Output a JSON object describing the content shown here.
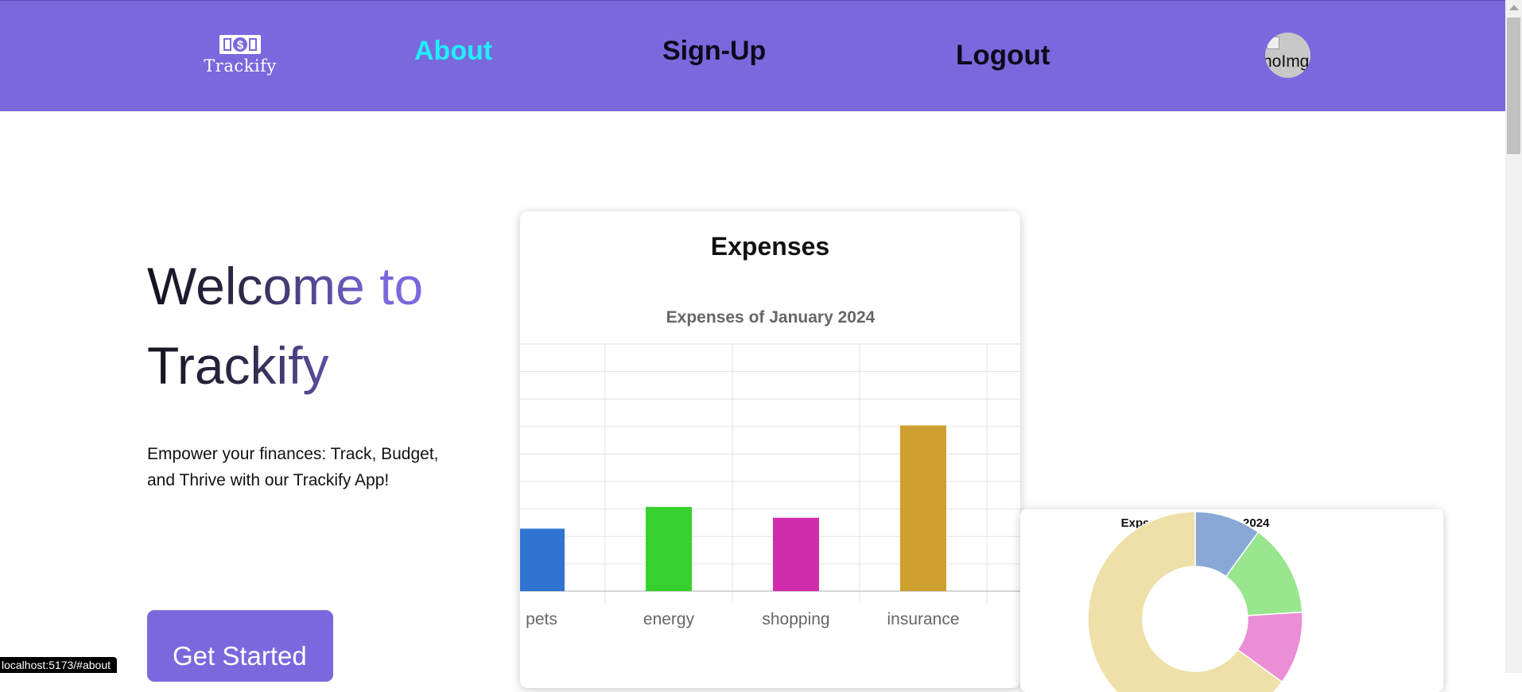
{
  "navbar": {
    "logo_text": "Trackify",
    "about": "About",
    "signup": "Sign-Up",
    "logout": "Logout",
    "avatar_alt": "noImg",
    "active_color": "#1ff0ff",
    "background": "#7b68dd"
  },
  "hero": {
    "title_line1": "Welcome to",
    "title_line2": "Trackify",
    "tagline": "Empower your finances: Track, Budget, and Thrive with our Trackify App!",
    "cta": "Get Started"
  },
  "expenses_card": {
    "heading": "Expenses"
  },
  "status_url": "localhost:5173/#about",
  "chart_data": [
    {
      "type": "bar",
      "title": "Expenses of January 2024",
      "categories": [
        "pets",
        "energy",
        "shopping",
        "insurance"
      ],
      "values": [
        23,
        31,
        27,
        61
      ],
      "colors": [
        "#2f74d0",
        "#36d12e",
        "#d12ca9",
        "#cfa02e"
      ],
      "ylim": [
        0,
        91
      ],
      "grid": true,
      "legend": "none"
    },
    {
      "type": "pie",
      "donut": true,
      "title": "Expenses in January 2024",
      "slices": [
        {
          "value": 10,
          "color": "#88a9d6"
        },
        {
          "value": 14,
          "color": "#98e68e"
        },
        {
          "value": 11,
          "color": "#ea8ed6"
        },
        {
          "value": 65,
          "color": "#eee0a8"
        }
      ]
    }
  ]
}
